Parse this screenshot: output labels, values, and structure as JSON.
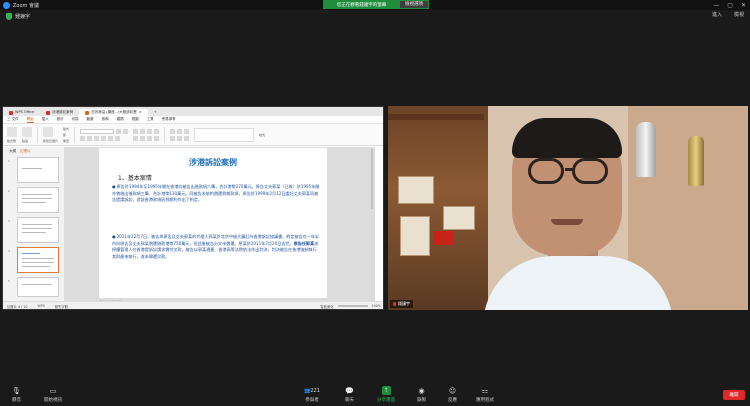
{
  "window": {
    "title": "Zoom 會議",
    "controls": [
      "—",
      "▢",
      "✕"
    ]
  },
  "share_banner": {
    "status": "您正在觀看錢鐘宇的螢幕",
    "view_options": "檢視選項"
  },
  "meeting_top": {
    "host_label": "鍾鐘宇",
    "enter_label": "進入",
    "view_label": "檢視"
  },
  "wps": {
    "tabs": [
      {
        "label": "WPS Office",
        "color": "#d02f2f"
      },
      {
        "label": "涉港訴訟案例",
        "color": "#d02f2f"
      },
      {
        "label": "石灣港溢 (講座...)大陸訴訟實",
        "color": "#d5691c"
      }
    ],
    "menus": [
      "三 文件",
      "開始",
      "插入",
      "設計",
      "切換",
      "動畫",
      "放映",
      "審閱",
      "視圖",
      "工具",
      "會員專享"
    ],
    "selected_menu": "開始",
    "ribbon_labels": [
      "格式刷",
      "粘貼",
      "新建幻燈片",
      "版式",
      "節",
      "重置",
      "樣式"
    ],
    "left_tabs": [
      "大綱",
      "幻燈片"
    ],
    "selected_left_tab": "幻燈片",
    "slide_numbers": [
      "1",
      "2",
      "3",
      "4",
      "5"
    ],
    "selected_slide": 4,
    "slide": {
      "title": "涉港訴訟案例",
      "heading": "1、基本案情",
      "para1_prefix": "原告於1994年至1995年間在香港向被告出借款項六筆，合計港幣270萬元。原告丈夫郭某（已故）於1995年間亦曾借出借款項三筆，合計港幣130萬元。同被告未依約償還到期款項，原告於1999年2月12日委託丈夫郭某同被告提請訴訟，對該香港款項因到期利作出了約定。",
      "para2_prefix": "2011年12月7日，被告與原告及丈夫郭某的代理人郭某於北京中級大廳訂內香港訴訟協議書，約定被告在一年半內向原告及丈夫郭某償還借款港幣750萬元，但此後被告分文未償還。原某於2011年7月20日去世。",
      "para2_bold": "原告任郭某",
      "para2_suffix": "遂授權管理人在香港提訴訟請求償付欠款，被告以郭某遺產、香港高等法院依法作出判決，判決被告在香港強制執行其財產來執行，遂未歸還欠款。"
    },
    "notes_placeholder": "單擊此處添加備注",
    "status": {
      "slide_count": "幻燈片 4 / 10",
      "theme": "WPS",
      "note_label": "缺失字體",
      "view_label": "智能美化",
      "zoom": "100%"
    }
  },
  "video": {
    "name": "錢鐘宇"
  },
  "toolbar": {
    "items": [
      {
        "label": "靜音",
        "icon": "mic-icon"
      },
      {
        "label": "開始視訊",
        "icon": "video-icon"
      },
      {
        "label": "參與者",
        "icon": "participants-icon",
        "count": "221"
      },
      {
        "label": "聊天",
        "icon": "chat-icon"
      },
      {
        "label": "分享畫面",
        "icon": "share-icon"
      },
      {
        "label": "錄製",
        "icon": "record-icon"
      },
      {
        "label": "反應",
        "icon": "reactions-icon"
      },
      {
        "label": "應用程式",
        "icon": "apps-icon"
      }
    ],
    "end_label": "離開"
  },
  "colors": {
    "share_green": "#1f8d3c",
    "end_red": "#e02828",
    "slide_title_blue": "#1d6fb8"
  }
}
